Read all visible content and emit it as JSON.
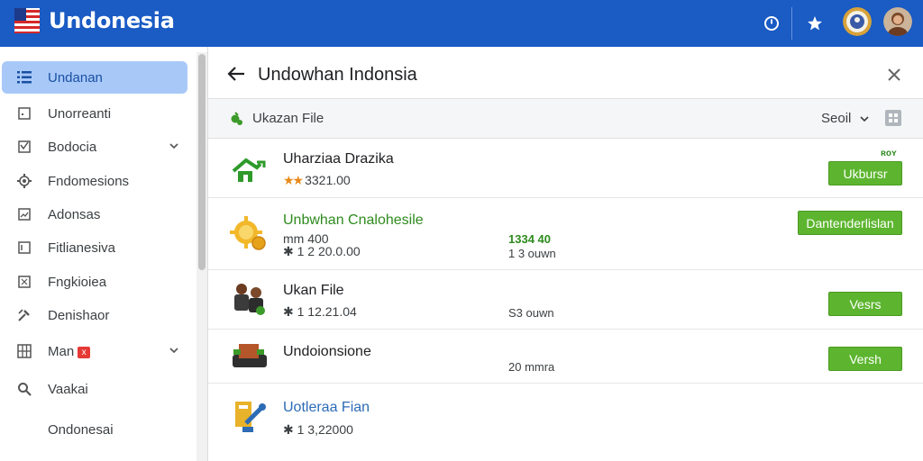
{
  "app": {
    "brand": "Undonesia"
  },
  "colors": {
    "topbar": "#1a5bc4",
    "accent_green": "#5db52f",
    "active_item": "#a8c9f8"
  },
  "topbar": {
    "icons": [
      "timer-icon",
      "star-icon"
    ]
  },
  "sidebar": {
    "items": [
      {
        "label": "Undanan",
        "icon": "list-icon",
        "active": true
      },
      {
        "label": "Unorreanti",
        "icon": "square-icon"
      },
      {
        "label": "Bodocia",
        "icon": "checkbox-icon",
        "expandable": true
      },
      {
        "label": "Fndomesions",
        "icon": "gear-icon"
      },
      {
        "label": "Adonsas",
        "icon": "chart-icon"
      },
      {
        "label": "Fitlianesiva",
        "icon": "document-icon"
      },
      {
        "label": "Fngkioiea",
        "icon": "puzzle-icon"
      },
      {
        "label": "Denishaor",
        "icon": "tools-icon"
      },
      {
        "label": "Man",
        "icon": "grid-icon",
        "badge": "x",
        "expandable": true
      },
      {
        "label": "Vaakai",
        "icon": "search-icon"
      },
      {
        "label": "Ondonesai",
        "icon": ""
      }
    ]
  },
  "main": {
    "title": "Undowhan Indonsia",
    "subheader": {
      "label": "Ukazan File",
      "sort_label": "Seoil"
    },
    "tiny_label": "ʀᴏʏ",
    "rows": [
      {
        "title": "Uharziaa Drazika",
        "sub": "3321.00",
        "stars": "★★",
        "mid": "",
        "mid_green": "",
        "button": "Ukbursr",
        "title_style": "normal"
      },
      {
        "title": "Unbwhan Cnalohesile",
        "sub_top": "mm 400",
        "sub": "✱ 1  2 20.0.00",
        "mid_green": "1334 40",
        "mid": "1 3 ouwn",
        "button": "Dantenderlislan",
        "title_style": "green"
      },
      {
        "title": "Ukan File",
        "sub": "✱ 1  12.21.04",
        "mid": "S3 ouwn",
        "button": "Vesrs",
        "title_style": "normal"
      },
      {
        "title": "Undoionsione",
        "sub": "",
        "mid": "20 mmra",
        "button": "Versh",
        "title_style": "normal"
      },
      {
        "title": "Uotleraa Fian",
        "sub": "✱ 1  3,22000",
        "mid": "",
        "button": "",
        "title_style": "blue"
      }
    ]
  }
}
